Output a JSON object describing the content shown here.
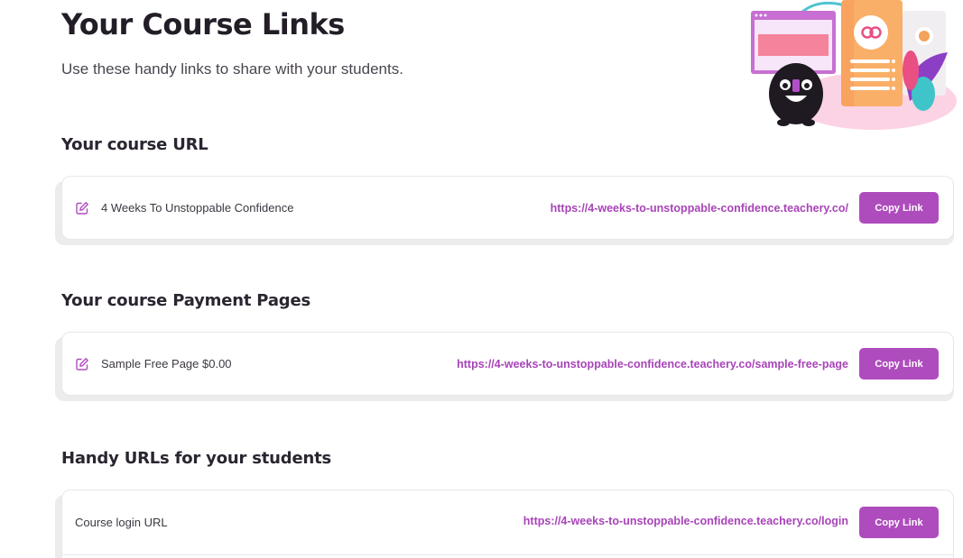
{
  "page": {
    "title": "Your Course Links",
    "subtitle": "Use these handy links to share with your students."
  },
  "colors": {
    "accent": "#ae4cbd",
    "link": "#a844b8"
  },
  "sections": [
    {
      "heading": "Your course URL",
      "rows": [
        {
          "icon": "edit-icon",
          "label": "4 Weeks To Unstoppable Confidence",
          "url": "https://4-weeks-to-unstoppable-confidence.teachery.co/",
          "button": "Copy Link"
        }
      ]
    },
    {
      "heading": "Your course Payment Pages",
      "rows": [
        {
          "icon": "edit-icon",
          "label": "Sample Free Page $0.00",
          "url": "https://4-weeks-to-unstoppable-confidence.teachery.co/sample-free-page",
          "button": "Copy Link"
        }
      ]
    },
    {
      "heading": "Handy URLs for your students",
      "rows": [
        {
          "label": "Course login URL",
          "url": "https://4-weeks-to-unstoppable-confidence.teachery.co/login",
          "button": "Copy Link"
        }
      ]
    }
  ]
}
